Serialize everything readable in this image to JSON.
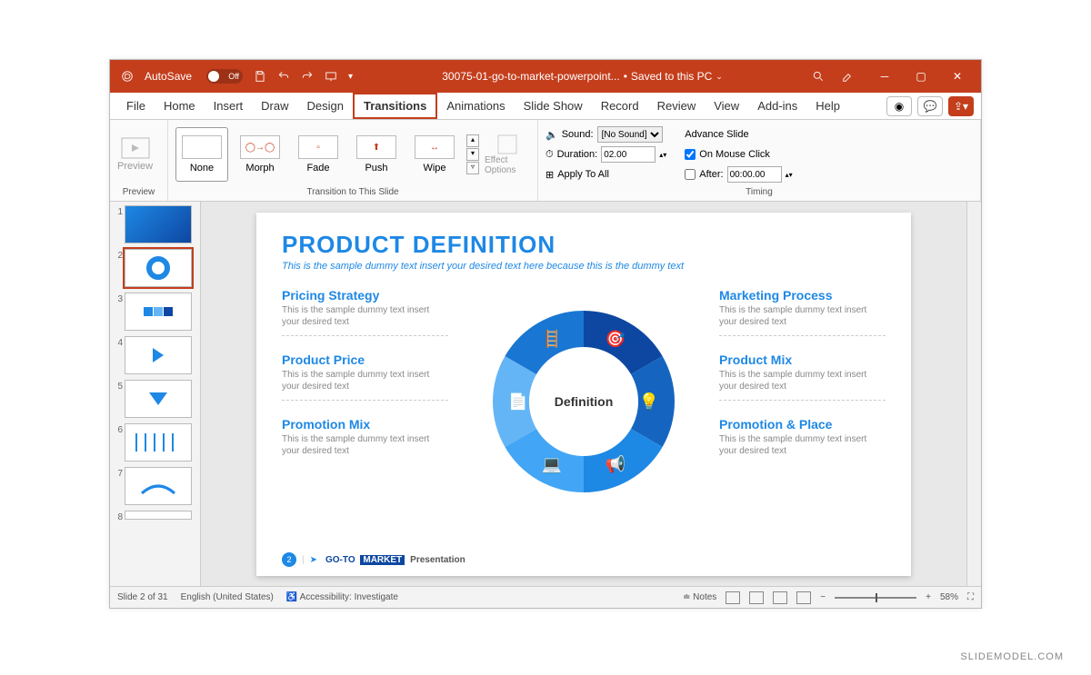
{
  "titlebar": {
    "autosave_label": "AutoSave",
    "autosave_state": "Off",
    "filename": "30075-01-go-to-market-powerpoint...",
    "save_state": "Saved to this PC"
  },
  "tabs": [
    "File",
    "Home",
    "Insert",
    "Draw",
    "Design",
    "Transitions",
    "Animations",
    "Slide Show",
    "Record",
    "Review",
    "View",
    "Add-ins",
    "Help"
  ],
  "active_tab": "Transitions",
  "ribbon": {
    "preview": "Preview",
    "transitions": [
      "None",
      "Morph",
      "Fade",
      "Push",
      "Wipe"
    ],
    "group_preview": "Preview",
    "group_trans": "Transition to This Slide",
    "effect_options": "Effect Options",
    "sound_label": "Sound:",
    "sound_value": "[No Sound]",
    "duration_label": "Duration:",
    "duration_value": "02.00",
    "apply_all": "Apply To All",
    "advance_label": "Advance Slide",
    "on_click": "On Mouse Click",
    "after_label": "After:",
    "after_value": "00:00.00",
    "group_timing": "Timing"
  },
  "slide": {
    "title": "PRODUCT DEFINITION",
    "subtitle": "This is the sample dummy text insert your desired text here because this is the dummy text",
    "center": "Definition",
    "left": [
      {
        "h": "Pricing Strategy",
        "p": "This is the sample dummy text insert your desired text"
      },
      {
        "h": "Product Price",
        "p": "This is the sample dummy text insert your desired text"
      },
      {
        "h": "Promotion Mix",
        "p": "This is the sample dummy text insert your desired text"
      }
    ],
    "right": [
      {
        "h": "Marketing Process",
        "p": "This is the sample dummy text insert your desired text"
      },
      {
        "h": "Product Mix",
        "p": "This is the sample dummy text insert your desired text"
      },
      {
        "h": "Promotion & Place",
        "p": "This is the sample dummy text insert your desired text"
      }
    ],
    "footer_num": "2",
    "footer_logo1": "GO-TO",
    "footer_logo2": "MARKET",
    "footer_text": "Presentation"
  },
  "thumbs": {
    "count": 8,
    "selected": 2
  },
  "status": {
    "slide": "Slide 2 of 31",
    "lang": "English (United States)",
    "access": "Accessibility: Investigate",
    "notes": "Notes",
    "zoom": "58%"
  },
  "watermark": "SLIDEMODEL.COM"
}
